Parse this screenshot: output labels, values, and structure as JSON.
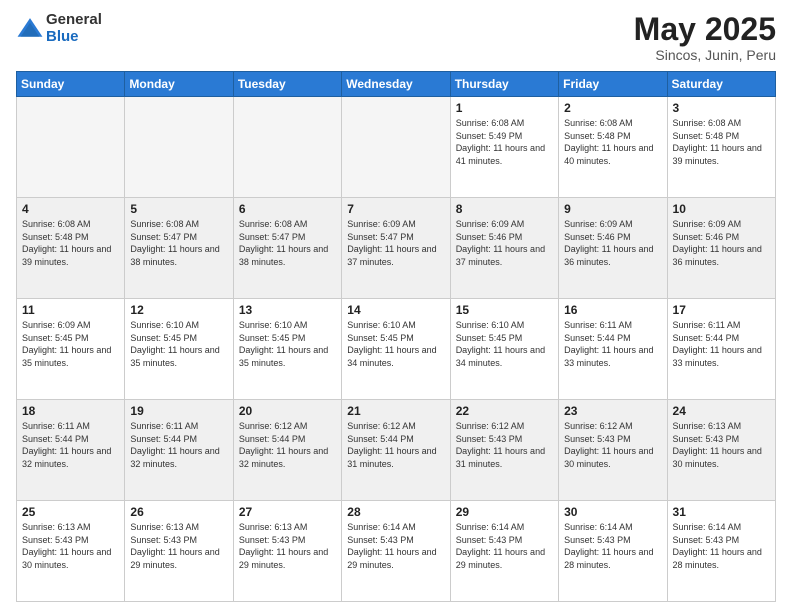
{
  "logo": {
    "general": "General",
    "blue": "Blue"
  },
  "header": {
    "month": "May 2025",
    "location": "Sincos, Junin, Peru"
  },
  "weekdays": [
    "Sunday",
    "Monday",
    "Tuesday",
    "Wednesday",
    "Thursday",
    "Friday",
    "Saturday"
  ],
  "weeks": [
    [
      {
        "day": "",
        "info": ""
      },
      {
        "day": "",
        "info": ""
      },
      {
        "day": "",
        "info": ""
      },
      {
        "day": "",
        "info": ""
      },
      {
        "day": "1",
        "info": "Sunrise: 6:08 AM\nSunset: 5:49 PM\nDaylight: 11 hours and 41 minutes."
      },
      {
        "day": "2",
        "info": "Sunrise: 6:08 AM\nSunset: 5:48 PM\nDaylight: 11 hours and 40 minutes."
      },
      {
        "day": "3",
        "info": "Sunrise: 6:08 AM\nSunset: 5:48 PM\nDaylight: 11 hours and 39 minutes."
      }
    ],
    [
      {
        "day": "4",
        "info": "Sunrise: 6:08 AM\nSunset: 5:48 PM\nDaylight: 11 hours and 39 minutes."
      },
      {
        "day": "5",
        "info": "Sunrise: 6:08 AM\nSunset: 5:47 PM\nDaylight: 11 hours and 38 minutes."
      },
      {
        "day": "6",
        "info": "Sunrise: 6:08 AM\nSunset: 5:47 PM\nDaylight: 11 hours and 38 minutes."
      },
      {
        "day": "7",
        "info": "Sunrise: 6:09 AM\nSunset: 5:47 PM\nDaylight: 11 hours and 37 minutes."
      },
      {
        "day": "8",
        "info": "Sunrise: 6:09 AM\nSunset: 5:46 PM\nDaylight: 11 hours and 37 minutes."
      },
      {
        "day": "9",
        "info": "Sunrise: 6:09 AM\nSunset: 5:46 PM\nDaylight: 11 hours and 36 minutes."
      },
      {
        "day": "10",
        "info": "Sunrise: 6:09 AM\nSunset: 5:46 PM\nDaylight: 11 hours and 36 minutes."
      }
    ],
    [
      {
        "day": "11",
        "info": "Sunrise: 6:09 AM\nSunset: 5:45 PM\nDaylight: 11 hours and 35 minutes."
      },
      {
        "day": "12",
        "info": "Sunrise: 6:10 AM\nSunset: 5:45 PM\nDaylight: 11 hours and 35 minutes."
      },
      {
        "day": "13",
        "info": "Sunrise: 6:10 AM\nSunset: 5:45 PM\nDaylight: 11 hours and 35 minutes."
      },
      {
        "day": "14",
        "info": "Sunrise: 6:10 AM\nSunset: 5:45 PM\nDaylight: 11 hours and 34 minutes."
      },
      {
        "day": "15",
        "info": "Sunrise: 6:10 AM\nSunset: 5:45 PM\nDaylight: 11 hours and 34 minutes."
      },
      {
        "day": "16",
        "info": "Sunrise: 6:11 AM\nSunset: 5:44 PM\nDaylight: 11 hours and 33 minutes."
      },
      {
        "day": "17",
        "info": "Sunrise: 6:11 AM\nSunset: 5:44 PM\nDaylight: 11 hours and 33 minutes."
      }
    ],
    [
      {
        "day": "18",
        "info": "Sunrise: 6:11 AM\nSunset: 5:44 PM\nDaylight: 11 hours and 32 minutes."
      },
      {
        "day": "19",
        "info": "Sunrise: 6:11 AM\nSunset: 5:44 PM\nDaylight: 11 hours and 32 minutes."
      },
      {
        "day": "20",
        "info": "Sunrise: 6:12 AM\nSunset: 5:44 PM\nDaylight: 11 hours and 32 minutes."
      },
      {
        "day": "21",
        "info": "Sunrise: 6:12 AM\nSunset: 5:44 PM\nDaylight: 11 hours and 31 minutes."
      },
      {
        "day": "22",
        "info": "Sunrise: 6:12 AM\nSunset: 5:43 PM\nDaylight: 11 hours and 31 minutes."
      },
      {
        "day": "23",
        "info": "Sunrise: 6:12 AM\nSunset: 5:43 PM\nDaylight: 11 hours and 30 minutes."
      },
      {
        "day": "24",
        "info": "Sunrise: 6:13 AM\nSunset: 5:43 PM\nDaylight: 11 hours and 30 minutes."
      }
    ],
    [
      {
        "day": "25",
        "info": "Sunrise: 6:13 AM\nSunset: 5:43 PM\nDaylight: 11 hours and 30 minutes."
      },
      {
        "day": "26",
        "info": "Sunrise: 6:13 AM\nSunset: 5:43 PM\nDaylight: 11 hours and 29 minutes."
      },
      {
        "day": "27",
        "info": "Sunrise: 6:13 AM\nSunset: 5:43 PM\nDaylight: 11 hours and 29 minutes."
      },
      {
        "day": "28",
        "info": "Sunrise: 6:14 AM\nSunset: 5:43 PM\nDaylight: 11 hours and 29 minutes."
      },
      {
        "day": "29",
        "info": "Sunrise: 6:14 AM\nSunset: 5:43 PM\nDaylight: 11 hours and 29 minutes."
      },
      {
        "day": "30",
        "info": "Sunrise: 6:14 AM\nSunset: 5:43 PM\nDaylight: 11 hours and 28 minutes."
      },
      {
        "day": "31",
        "info": "Sunrise: 6:14 AM\nSunset: 5:43 PM\nDaylight: 11 hours and 28 minutes."
      }
    ]
  ]
}
